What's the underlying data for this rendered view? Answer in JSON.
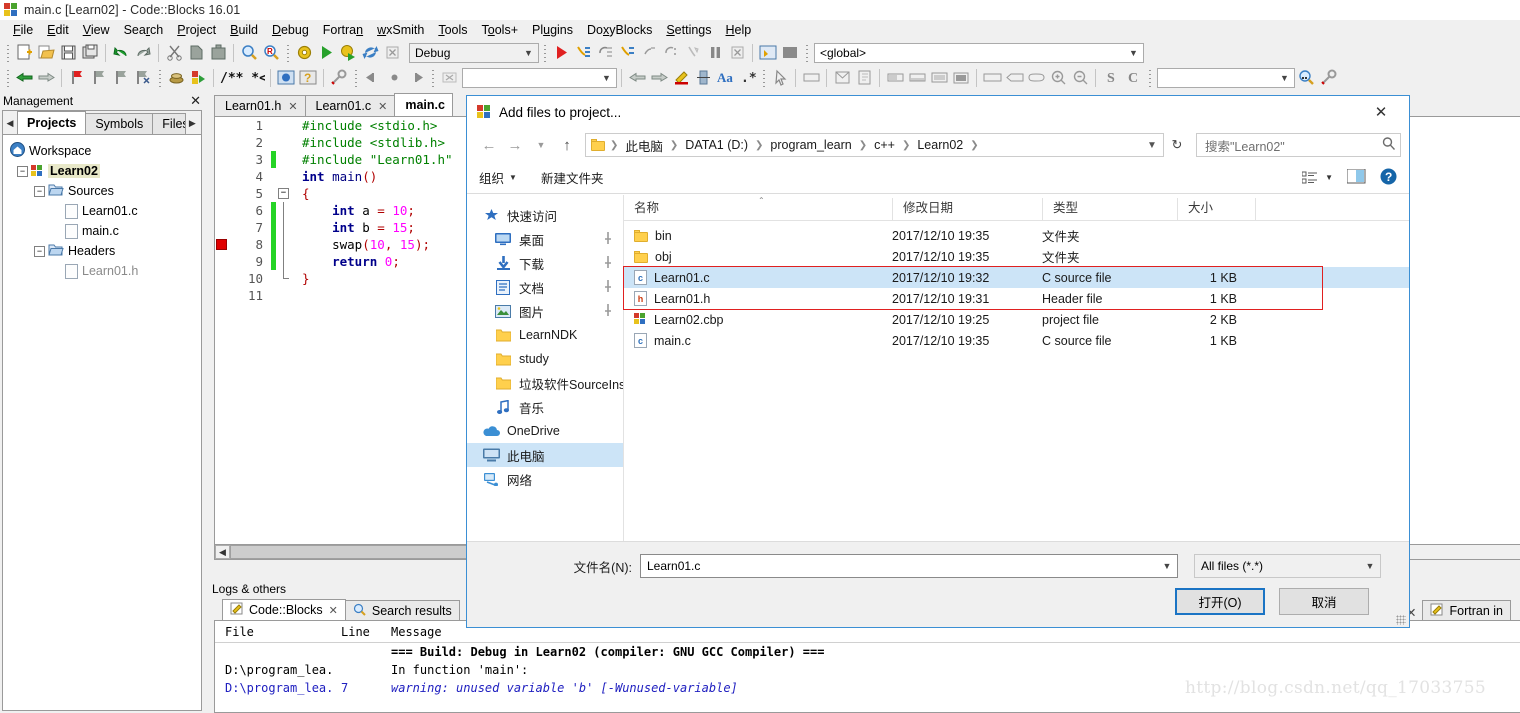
{
  "app": {
    "title": "main.c [Learn02] - Code::Blocks 16.01",
    "logo_icon": "codeblocks-logo-icon"
  },
  "menubar": [
    {
      "label": "File"
    },
    {
      "label": "Edit"
    },
    {
      "label": "View"
    },
    {
      "label": "Search"
    },
    {
      "label": "Project"
    },
    {
      "label": "Build"
    },
    {
      "label": "Debug"
    },
    {
      "label": "Fortran"
    },
    {
      "label": "wxSmith"
    },
    {
      "label": "Tools"
    },
    {
      "label": "Tools+"
    },
    {
      "label": "Plugins"
    },
    {
      "label": "DoxyBlocks"
    },
    {
      "label": "Settings"
    },
    {
      "label": "Help"
    }
  ],
  "toolbar": {
    "build_target": "Debug",
    "scope": "<global>",
    "search_value": "",
    "goto_value": ""
  },
  "management": {
    "title": "Management",
    "close_icon": "close-icon",
    "tabs": [
      {
        "label": "Projects",
        "active": true
      },
      {
        "label": "Symbols",
        "active": false
      },
      {
        "label": "Files",
        "active": false
      }
    ],
    "tree": {
      "workspace": "Workspace",
      "project": "Learn02",
      "groups": [
        {
          "label": "Sources",
          "files": [
            "Learn01.c",
            "main.c"
          ]
        },
        {
          "label": "Headers",
          "files": [
            "Learn01.h"
          ]
        }
      ]
    }
  },
  "editor": {
    "tabs": [
      {
        "label": "Learn01.h",
        "active": false
      },
      {
        "label": "Learn01.c",
        "active": false
      },
      {
        "label": "main.c",
        "active": true
      }
    ],
    "lines": [
      {
        "n": 1,
        "changed": false,
        "breakpoint": false,
        "fold": "none",
        "tokens": [
          {
            "t": "#include <stdio.h>",
            "c": "pre"
          }
        ]
      },
      {
        "n": 2,
        "changed": false,
        "breakpoint": false,
        "fold": "none",
        "tokens": [
          {
            "t": "#include <stdlib.h>",
            "c": "pre"
          }
        ]
      },
      {
        "n": 3,
        "changed": true,
        "breakpoint": false,
        "fold": "none",
        "tokens": [
          {
            "t": "#include \"Learn01.h\"",
            "c": "pre"
          }
        ]
      },
      {
        "n": 4,
        "changed": false,
        "breakpoint": false,
        "fold": "none",
        "tokens": [
          {
            "t": "int",
            "c": "kw"
          },
          {
            "t": " ",
            "c": "pl"
          },
          {
            "t": "main",
            "c": "fn"
          },
          {
            "t": "()",
            "c": "br"
          }
        ]
      },
      {
        "n": 5,
        "changed": false,
        "breakpoint": false,
        "fold": "start",
        "tokens": [
          {
            "t": "{",
            "c": "br"
          }
        ]
      },
      {
        "n": 6,
        "changed": true,
        "breakpoint": false,
        "fold": "mid",
        "tokens": [
          {
            "t": "    ",
            "c": "pl"
          },
          {
            "t": "int",
            "c": "kw"
          },
          {
            "t": " a ",
            "c": "pl"
          },
          {
            "t": "=",
            "c": "op"
          },
          {
            "t": " ",
            "c": "pl"
          },
          {
            "t": "10",
            "c": "num"
          },
          {
            "t": ";",
            "c": "op"
          }
        ]
      },
      {
        "n": 7,
        "changed": true,
        "breakpoint": false,
        "fold": "mid",
        "tokens": [
          {
            "t": "    ",
            "c": "pl"
          },
          {
            "t": "int",
            "c": "kw"
          },
          {
            "t": " b ",
            "c": "pl"
          },
          {
            "t": "=",
            "c": "op"
          },
          {
            "t": " ",
            "c": "pl"
          },
          {
            "t": "15",
            "c": "num"
          },
          {
            "t": ";",
            "c": "op"
          }
        ]
      },
      {
        "n": 8,
        "changed": true,
        "breakpoint": true,
        "fold": "mid",
        "tokens": [
          {
            "t": "    ",
            "c": "pl"
          },
          {
            "t": "swap",
            "c": "pl"
          },
          {
            "t": "(",
            "c": "br"
          },
          {
            "t": "10",
            "c": "num"
          },
          {
            "t": ", ",
            "c": "br"
          },
          {
            "t": "15",
            "c": "num"
          },
          {
            "t": ");",
            "c": "br"
          }
        ]
      },
      {
        "n": 9,
        "changed": true,
        "breakpoint": false,
        "fold": "mid",
        "tokens": [
          {
            "t": "    ",
            "c": "pl"
          },
          {
            "t": "return",
            "c": "kw"
          },
          {
            "t": " ",
            "c": "pl"
          },
          {
            "t": "0",
            "c": "num"
          },
          {
            "t": ";",
            "c": "op"
          }
        ]
      },
      {
        "n": 10,
        "changed": false,
        "breakpoint": false,
        "fold": "end",
        "tokens": [
          {
            "t": "}",
            "c": "br"
          }
        ]
      },
      {
        "n": 11,
        "changed": false,
        "breakpoint": false,
        "fold": "none",
        "tokens": []
      }
    ]
  },
  "logs": {
    "title": "Logs & others",
    "tabs": [
      {
        "label": "Code::Blocks",
        "active": true,
        "icon": "pencil-icon",
        "closable": true
      },
      {
        "label": "Search results",
        "active": false,
        "icon": "search-icon",
        "closable": false
      },
      {
        "label": "Fortran in",
        "active": false,
        "icon": "pencil-icon",
        "closable": false
      }
    ],
    "columns": [
      "File",
      "Line",
      "Message"
    ],
    "rows": [
      {
        "file": "",
        "line": "",
        "message": "=== Build: Debug in Learn02 (compiler: GNU GCC Compiler) ===",
        "style": "bold"
      },
      {
        "file": "D:\\program_lea...",
        "line": "",
        "message": "In function 'main':",
        "style": "plain"
      },
      {
        "file": "D:\\program_lea...",
        "line": "7",
        "message": "warning: unused variable 'b' [-Wunused-variable]",
        "style": "warn"
      }
    ]
  },
  "watermark": "http://blog.csdn.net/qq_17033755",
  "dialog": {
    "title": "Add files to project...",
    "title_icon": "codeblocks-logo-icon",
    "close_icon": "close-icon",
    "nav": {
      "back_icon": "arrow-left-icon",
      "forward_icon": "arrow-right-icon",
      "recent_icon": "chevron-down-icon",
      "up_icon": "arrow-up-icon",
      "refresh_icon": "refresh-icon"
    },
    "breadcrumbs": [
      "此电脑",
      "DATA1 (D:)",
      "program_learn",
      "c++",
      "Learn02"
    ],
    "search_placeholder": "搜索\"Learn02\"",
    "commands": {
      "organize": "组织",
      "new_folder": "新建文件夹",
      "view_icon": "view-list-icon",
      "preview_icon": "preview-pane-icon",
      "help_icon": "help-icon"
    },
    "nav_pane": [
      {
        "label": "快速访问",
        "icon": "quick-access-icon",
        "indent": false,
        "pinned": false,
        "selected": false
      },
      {
        "label": "桌面",
        "icon": "desktop-icon",
        "indent": true,
        "pinned": true,
        "selected": false
      },
      {
        "label": "下载",
        "icon": "downloads-icon",
        "indent": true,
        "pinned": true,
        "selected": false
      },
      {
        "label": "文档",
        "icon": "documents-icon",
        "indent": true,
        "pinned": true,
        "selected": false
      },
      {
        "label": "图片",
        "icon": "pictures-icon",
        "indent": true,
        "pinned": true,
        "selected": false
      },
      {
        "label": "LearnNDK",
        "icon": "folder-icon",
        "indent": true,
        "pinned": false,
        "selected": false
      },
      {
        "label": "study",
        "icon": "folder-icon",
        "indent": true,
        "pinned": false,
        "selected": false
      },
      {
        "label": "垃圾软件SourceIns",
        "icon": "folder-icon",
        "indent": true,
        "pinned": false,
        "selected": false
      },
      {
        "label": "音乐",
        "icon": "music-icon",
        "indent": true,
        "pinned": false,
        "selected": false
      },
      {
        "label": "OneDrive",
        "icon": "onedrive-icon",
        "indent": false,
        "pinned": false,
        "selected": false
      },
      {
        "label": "此电脑",
        "icon": "this-pc-icon",
        "indent": false,
        "pinned": false,
        "selected": true
      },
      {
        "label": "网络",
        "icon": "network-icon",
        "indent": false,
        "pinned": false,
        "selected": false
      }
    ],
    "columns": [
      "名称",
      "修改日期",
      "类型",
      "大小"
    ],
    "files": [
      {
        "name": "bin",
        "date": "2017/12/10 19:35",
        "type": "文件夹",
        "size": "",
        "icon": "folder-icon",
        "selected": false
      },
      {
        "name": "obj",
        "date": "2017/12/10 19:35",
        "type": "文件夹",
        "size": "",
        "icon": "folder-icon",
        "selected": false
      },
      {
        "name": "Learn01.c",
        "date": "2017/12/10 19:32",
        "type": "C source file",
        "size": "1 KB",
        "icon": "c-file-icon",
        "selected": true
      },
      {
        "name": "Learn01.h",
        "date": "2017/12/10 19:31",
        "type": "Header file",
        "size": "1 KB",
        "icon": "h-file-icon",
        "selected": false
      },
      {
        "name": "Learn02.cbp",
        "date": "2017/12/10 19:25",
        "type": "project file",
        "size": "2 KB",
        "icon": "cbp-file-icon",
        "selected": false
      },
      {
        "name": "main.c",
        "date": "2017/12/10 19:35",
        "type": "C source file",
        "size": "1 KB",
        "icon": "c-file-icon",
        "selected": false
      }
    ],
    "filename_label": "文件名(N):",
    "filename_value": "Learn01.c",
    "filetype_value": "All files (*.*)",
    "open_button": "打开(O)",
    "cancel_button": "取消"
  },
  "colors": {
    "accent": "#1b74c4",
    "selection": "#cce4f7",
    "highlight_box": "#e02020",
    "changed_marker": "#25d425",
    "breakpoint": "#e00000"
  }
}
